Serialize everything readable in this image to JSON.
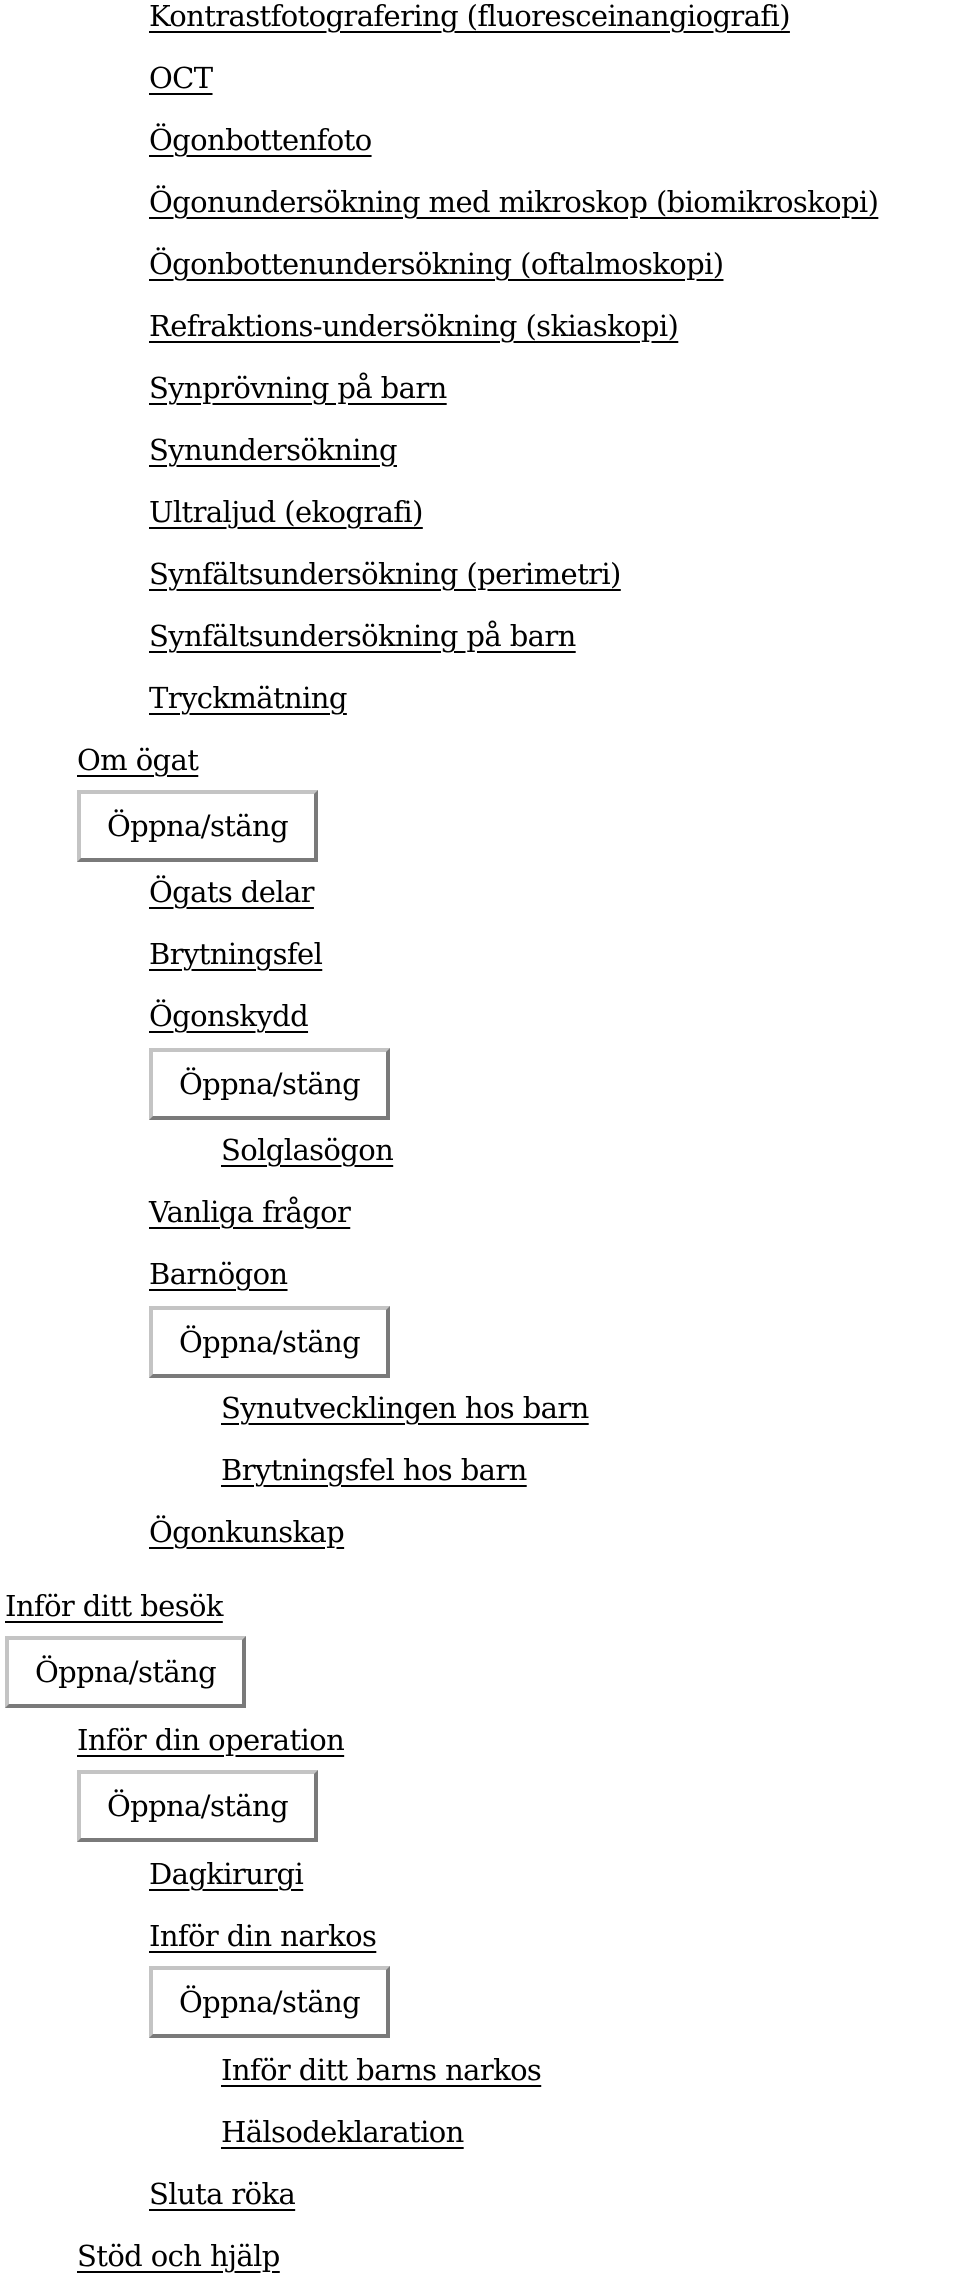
{
  "toggle_label": "Öppna/stäng",
  "nav": {
    "undersokningar": [
      "Kontrastfotografering (fluoresceinangiografi)",
      "OCT",
      "Ögonbottenfoto",
      "Ögonundersökning med mikroskop (biomikroskopi)",
      "Ögonbottenundersökning (oftalmoskopi)",
      "Refraktions-undersökning (skiaskopi)",
      "Synprövning på barn",
      "Synundersökning",
      "Ultraljud (ekografi)",
      "Synfältsundersökning (perimetri)",
      "Synfältsundersökning på barn",
      "Tryckmätning"
    ],
    "om_ogat": {
      "label": "Om ögat",
      "children": {
        "ogats_delar": "Ögats delar",
        "brytningsfel": "Brytningsfel",
        "ogonskydd": {
          "label": "Ögonskydd",
          "children": [
            "Solglasögon"
          ]
        },
        "vanliga_fragor": "Vanliga frågor",
        "barnogon": {
          "label": "Barnögon",
          "children": [
            "Synutvecklingen hos barn",
            "Brytningsfel hos barn"
          ]
        },
        "ogonkunskap": "Ögonkunskap"
      }
    },
    "infor_ditt_besok": {
      "label": "Inför ditt besök",
      "infor_din_operation": {
        "label": "Inför din operation",
        "dagkirurgi": "Dagkirurgi",
        "infor_din_narkos": {
          "label": "Inför din narkos",
          "children": [
            "Inför ditt barns narkos",
            "Hälsodeklaration"
          ]
        },
        "sluta_roka": "Sluta röka"
      },
      "stod_och_hjalp": "Stöd och hjälp"
    }
  }
}
